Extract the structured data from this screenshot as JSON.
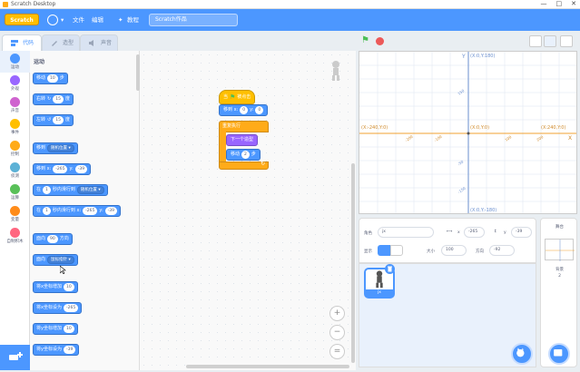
{
  "window": {
    "title": "Scratch Desktop",
    "min": "—",
    "max": "□",
    "close": "✕"
  },
  "menu": {
    "logo": "Scratch",
    "file": "文件",
    "edit": "编辑",
    "tutorials": "教程",
    "project_name": "Scratch作品"
  },
  "tabs": {
    "code": "代码",
    "costumes": "造型",
    "sounds": "声音"
  },
  "categories": [
    {
      "label": "运动",
      "color": "#4c97ff"
    },
    {
      "label": "外观",
      "color": "#9966ff"
    },
    {
      "label": "声音",
      "color": "#cf63cf"
    },
    {
      "label": "事件",
      "color": "#ffbf00"
    },
    {
      "label": "控制",
      "color": "#ffab19"
    },
    {
      "label": "侦测",
      "color": "#5cb1d6"
    },
    {
      "label": "运算",
      "color": "#59c059"
    },
    {
      "label": "变量",
      "color": "#ff8c1a"
    },
    {
      "label": "自制积木",
      "color": "#ff6680"
    }
  ],
  "palette": {
    "title": "运动",
    "move": {
      "a": "移动",
      "v": "10",
      "b": "步"
    },
    "turn_right": {
      "a": "右转",
      "v": "15",
      "b": "度"
    },
    "turn_left": {
      "a": "左转",
      "v": "15",
      "b": "度"
    },
    "goto": {
      "a": "移到",
      "dd": "随机位置 ▾"
    },
    "goto_xy": {
      "a": "移到 x:",
      "x": "-265",
      "b": "y:",
      "y": "-39"
    },
    "glide": {
      "a": "在",
      "v": "1",
      "b": "秒内滑行到",
      "dd": "随机位置 ▾"
    },
    "glide_xy": {
      "a": "在",
      "v": "1",
      "b": "秒内滑行到 x:",
      "x": "-265",
      "c": "y:",
      "y": "-39"
    },
    "point_dir": {
      "a": "面向",
      "v": "90",
      "b": "方向"
    },
    "point_to": {
      "a": "面向",
      "dd": "鼠标指针 ▾"
    },
    "change_x": {
      "a": "将x坐标增加",
      "v": "10"
    },
    "set_x": {
      "a": "将x坐标设为",
      "v": "-265"
    },
    "change_y": {
      "a": "将y坐标增加",
      "v": "10"
    },
    "set_y": {
      "a": "将y坐标设为",
      "v": "-39"
    }
  },
  "script": {
    "hat": {
      "a": "当",
      "b": "被点击"
    },
    "goto_xy": {
      "a": "移到 x:",
      "x": "0",
      "b": "y:",
      "y": "0"
    },
    "forever": "重复执行",
    "custom": "下一个造型",
    "move": {
      "a": "移动",
      "v": "2",
      "b": "步"
    }
  },
  "zoom": {
    "in": "+",
    "out": "−",
    "reset": "="
  },
  "stage": {
    "y_top": "(X:0,Y:180)",
    "x_left": "(X:-240,Y:0)",
    "center": "(X:0,Y:0)",
    "x_right": "(X:240,Y:0)",
    "y_bottom": "(X:0,Y:-180)",
    "x_axis": "X",
    "y_axis": "Y",
    "ticks": [
      "-200",
      "-100",
      "100",
      "200",
      "-150",
      "150",
      "-50"
    ]
  },
  "sprite": {
    "label_sprite": "角色",
    "name": "jx",
    "x_label": "x",
    "x": "-265",
    "y_label": "y",
    "y": "-39",
    "show_label": "显示",
    "size_label": "大小",
    "size": "100",
    "dir_label": "方向",
    "direction": "-92",
    "thumb_name": "jx"
  },
  "stage_panel": {
    "title": "舞台",
    "backdrop_label": "背景",
    "backdrop_count": "2"
  }
}
